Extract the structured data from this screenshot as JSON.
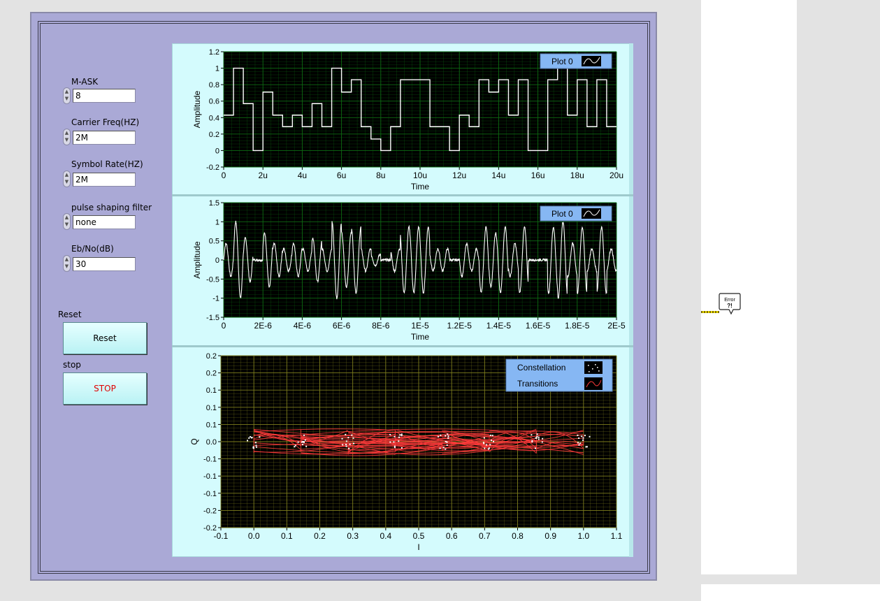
{
  "controls": {
    "m_ask": {
      "label": "M-ASK",
      "value": "8"
    },
    "carrier_freq": {
      "label": "Carrier Freq(HZ)",
      "value": "2M"
    },
    "symbol_rate": {
      "label": "Symbol Rate(HZ)",
      "value": "2M"
    },
    "pulse_filter": {
      "label": "pulse shaping filter",
      "value": "none"
    },
    "ebno": {
      "label": "Eb/No(dB)",
      "value": "30"
    }
  },
  "buttons": {
    "reset": {
      "caption": "Reset",
      "label": "Reset"
    },
    "stop": {
      "caption": "stop",
      "label": "STOP",
      "color": "#e00000"
    }
  },
  "colors": {
    "plot_bg": "#000000",
    "grid_time": "#0d6b12",
    "grid_const": "#7e7e1d",
    "trace": "#ffffff",
    "transition": "#ff3b3b",
    "legend": "#86b7f3"
  },
  "error_cluster": {
    "icon": "error-cluster-icon",
    "text": "Error"
  },
  "chart_data": [
    {
      "type": "line",
      "id": "baseband",
      "xlabel": "Time",
      "ylabel": "Amplitude",
      "xlim": [
        0,
        20
      ],
      "ylim": [
        -0.2,
        1.2
      ],
      "x_ticks": [
        "0",
        "2u",
        "4u",
        "6u",
        "8u",
        "10u",
        "12u",
        "14u",
        "16u",
        "18u",
        "20u"
      ],
      "y_ticks": [
        "-0.2",
        "0",
        "0.2",
        "0.4",
        "0.6",
        "0.8",
        "1",
        "1.2"
      ],
      "legend": "Plot 0",
      "series": [
        {
          "name": "Plot 0",
          "values": [
            0.43,
            1.0,
            0.57,
            0.0,
            0.71,
            0.43,
            0.29,
            0.43,
            0.29,
            0.57,
            0.29,
            1.0,
            0.71,
            0.86,
            0.29,
            0.14,
            0.0,
            0.29,
            0.86,
            0.86,
            0.86,
            0.29,
            0.29,
            0.0,
            0.43,
            0.29,
            0.86,
            0.71,
            0.86,
            0.43,
            0.86,
            0.0,
            0.0,
            0.86,
            1.0,
            0.43,
            0.86,
            0.29,
            0.86,
            0.29
          ]
        }
      ]
    },
    {
      "type": "line",
      "id": "modulated",
      "xlabel": "Time",
      "ylabel": "Amplitude",
      "xlim": [
        0,
        2e-05
      ],
      "ylim": [
        -1.5,
        1.5
      ],
      "x_ticks": [
        "0",
        "2E-6",
        "4E-6",
        "6E-6",
        "8E-6",
        "1E-5",
        "1.2E-5",
        "1.4E-5",
        "1.6E-5",
        "1.8E-5",
        "2E-5"
      ],
      "y_ticks": [
        "-1.5",
        "-1",
        "-0.5",
        "0",
        "0.5",
        "1",
        "1.5"
      ],
      "legend": "Plot 0",
      "carrier_freq_hz": 2000000
    },
    {
      "type": "scatter",
      "id": "constellation",
      "xlabel": "I",
      "ylabel": "Q",
      "xlim": [
        -0.1,
        1.1
      ],
      "ylim": [
        -0.2,
        0.2
      ],
      "x_ticks": [
        "-0.1",
        "0.0",
        "0.1",
        "0.2",
        "0.3",
        "0.4",
        "0.5",
        "0.6",
        "0.7",
        "0.8",
        "0.9",
        "1.0",
        "1.1"
      ],
      "y_ticks": [
        "-0.2",
        "-0.2",
        "-0.1",
        "-0.1",
        "-0.1",
        "0.0",
        "0.1",
        "0.1",
        "0.1",
        "0.2",
        "0.2"
      ],
      "legend": [
        "Constellation",
        "Transitions"
      ],
      "symbols": [
        0.0,
        0.143,
        0.286,
        0.429,
        0.571,
        0.714,
        0.857,
        1.0
      ]
    }
  ]
}
